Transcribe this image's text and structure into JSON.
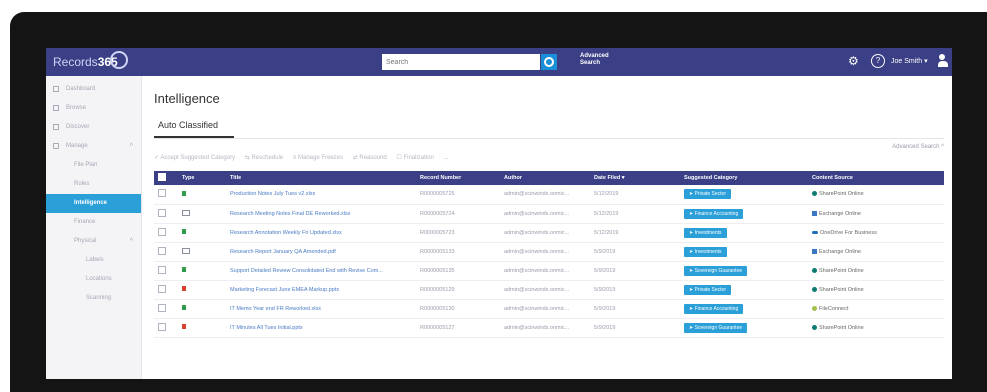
{
  "header": {
    "logo_prefix": "Records",
    "logo_suffix": "365",
    "search_placeholder": "Search",
    "advanced_search_line1": "Advanced",
    "advanced_search_line2": "Search",
    "user_name": "Joe Smith ▾",
    "help_glyph": "?",
    "gear_glyph": "⚙"
  },
  "sidebar": {
    "items": [
      {
        "label": "Dashboard"
      },
      {
        "label": "Browse"
      },
      {
        "label": "Discover"
      },
      {
        "label": "Manage",
        "chevron": "^"
      },
      {
        "label": "File Plan"
      },
      {
        "label": "Rules"
      },
      {
        "label": "Intelligence"
      },
      {
        "label": "Finance"
      },
      {
        "label": "Physical",
        "chevron": "^"
      },
      {
        "label": "Labels"
      },
      {
        "label": "Locations"
      },
      {
        "label": "Scanning"
      }
    ]
  },
  "main": {
    "title": "Intelligence",
    "tab": "Auto Classified",
    "advanced_search": "Advanced Search ^",
    "toolbar": [
      "✓ Accept Suggested Category",
      "⇆ Reschedule",
      "≡ Manage Freezes",
      "⇄ Reasound",
      "☐ Finalization",
      "..."
    ],
    "columns": [
      "Type",
      "Title",
      "Record Number",
      "Author",
      "Date Filed ▾",
      "Suggested Category",
      "Content Source"
    ],
    "rows": [
      {
        "type": "xls",
        "title": "Production Notes July Tues v2.xlsx",
        "record": "R0000005725",
        "author": "admin@scinwinds.onmic...",
        "date": "5/12/2019",
        "category": "Private Sector",
        "source": "SharePoint Online",
        "src_icon": "sp"
      },
      {
        "type": "mail",
        "title": "Research Meeting Notes Final DE Reworked.xlsx",
        "record": "R0000005724",
        "author": "admin@scinwinds.onmic...",
        "date": "5/12/2019",
        "category": "Finance Accounting",
        "source": "Exchange Online",
        "src_icon": "ex"
      },
      {
        "type": "xls",
        "title": "Research Annotation Weekly Fri Updated.xlsx",
        "record": "R0000005723",
        "author": "admin@scinwinds.onmic...",
        "date": "5/12/2019",
        "category": "Investments",
        "source": "OneDrive For Business",
        "src_icon": "od"
      },
      {
        "type": "mail",
        "title": "Research Report January QA Amended.pdf",
        "record": "R0000005133",
        "author": "admin@scinwinds.onmic...",
        "date": "5/9/2019",
        "category": "Investments",
        "source": "Exchange Online",
        "src_icon": "ex"
      },
      {
        "type": "xls",
        "title": "Support Detailed Review Consolidated End with Revise Com...",
        "record": "R0000005135",
        "author": "admin@scinwinds.onmic...",
        "date": "5/9/2019",
        "category": "Sovereign Guarantee",
        "source": "SharePoint Online",
        "src_icon": "sp"
      },
      {
        "type": "doc",
        "title": "Marketing Forecast June EMEA Markup.pptx",
        "record": "R0000005129",
        "author": "admin@scinwinds.onmic...",
        "date": "5/9/2019",
        "category": "Private Sector",
        "source": "SharePoint Online",
        "src_icon": "sp"
      },
      {
        "type": "xls",
        "title": "IT Memo Year end FR Reworked.xlsx",
        "record": "R0000005130",
        "author": "admin@scinwinds.onmic...",
        "date": "5/9/2019",
        "category": "Finance Accounting",
        "source": "FileConnect",
        "src_icon": "fc"
      },
      {
        "type": "doc",
        "title": "IT Minutes All Tues Initial.pptx",
        "record": "R0000005127",
        "author": "admin@scinwinds.onmic...",
        "date": "5/9/2019",
        "category": "Sovereign Guarantee",
        "source": "SharePoint Online",
        "src_icon": "sp"
      }
    ]
  },
  "colors": {
    "header_bg": "#3a3f86",
    "accent": "#2b9fd8",
    "bezel": "#141414"
  }
}
